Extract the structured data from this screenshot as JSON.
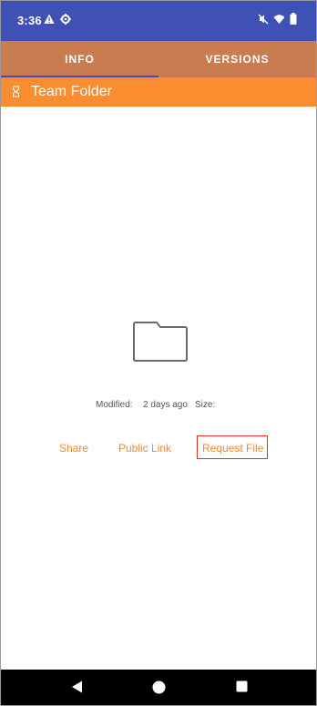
{
  "status_bar": {
    "time": "3:36",
    "icons": [
      "warning-icon",
      "settings-gear-icon",
      "mute-icon",
      "wifi-icon",
      "battery-icon"
    ]
  },
  "tabs": [
    {
      "label": "INFO",
      "selected": true
    },
    {
      "label": "VERSIONS",
      "selected": false
    }
  ],
  "header": {
    "title": "Team Folder",
    "icon": "hourglass-icon"
  },
  "details": {
    "modified_label": "Modified:",
    "modified_value": "2 days ago",
    "size_label": "Size:"
  },
  "actions": {
    "share": "Share",
    "public_link": "Public Link",
    "request_file": "Request File"
  },
  "colors": {
    "status_bar": "#3f51b5",
    "tabs_bg": "#c97c4f",
    "header_bg": "#fb8c2f",
    "action_text": "#ee8a2f",
    "highlight_border": "#e02b2b"
  },
  "nav_bar": {
    "icons": [
      "back-icon",
      "home-icon",
      "recents-icon"
    ]
  }
}
